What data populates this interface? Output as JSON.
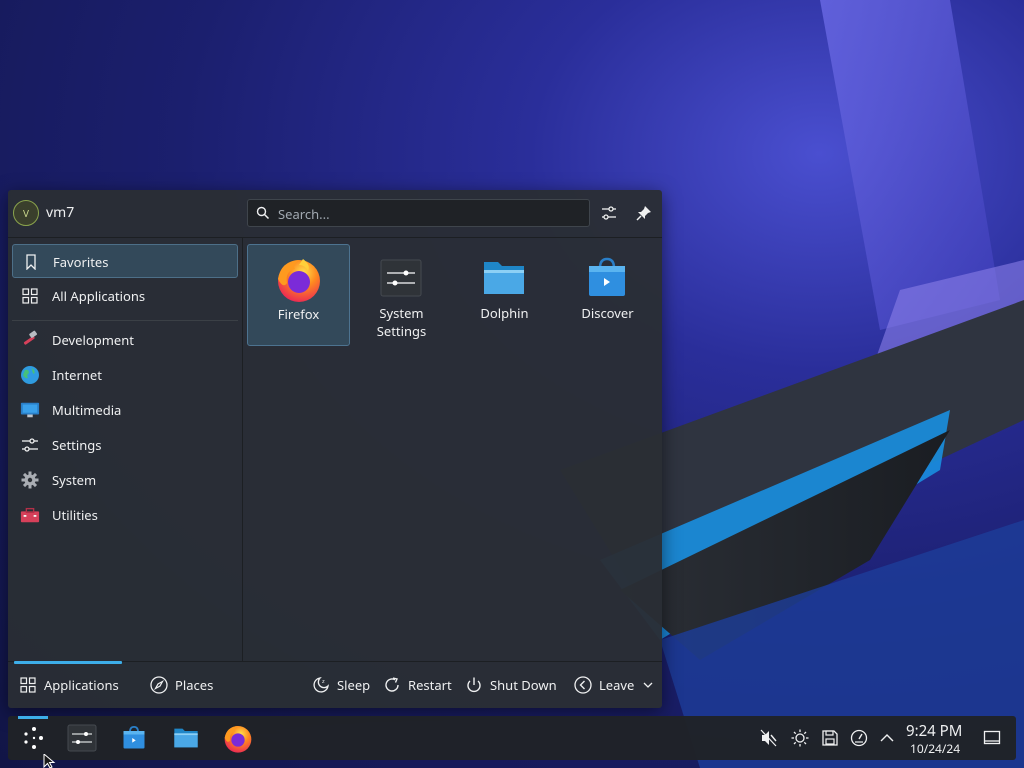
{
  "user": {
    "name": "vm7",
    "initial": "V"
  },
  "search": {
    "placeholder": "Search..."
  },
  "sidebar": {
    "items": [
      {
        "label": "Favorites"
      },
      {
        "label": "All Applications"
      },
      {
        "label": "Development"
      },
      {
        "label": "Internet"
      },
      {
        "label": "Multimedia"
      },
      {
        "label": "Settings"
      },
      {
        "label": "System"
      },
      {
        "label": "Utilities"
      }
    ]
  },
  "apps": [
    {
      "label": "Firefox"
    },
    {
      "label": "System Settings"
    },
    {
      "label": "Dolphin"
    },
    {
      "label": "Discover"
    }
  ],
  "footer": {
    "tabs": [
      {
        "label": "Applications"
      },
      {
        "label": "Places"
      }
    ],
    "actions": [
      {
        "label": "Sleep"
      },
      {
        "label": "Restart"
      },
      {
        "label": "Shut Down"
      },
      {
        "label": "Leave"
      }
    ]
  },
  "clock": {
    "time": "9:24 PM",
    "date": "10/24/24"
  },
  "colors": {
    "accent": "#3daee9",
    "panel": "#2a2e34",
    "highlight": "#33495a"
  }
}
